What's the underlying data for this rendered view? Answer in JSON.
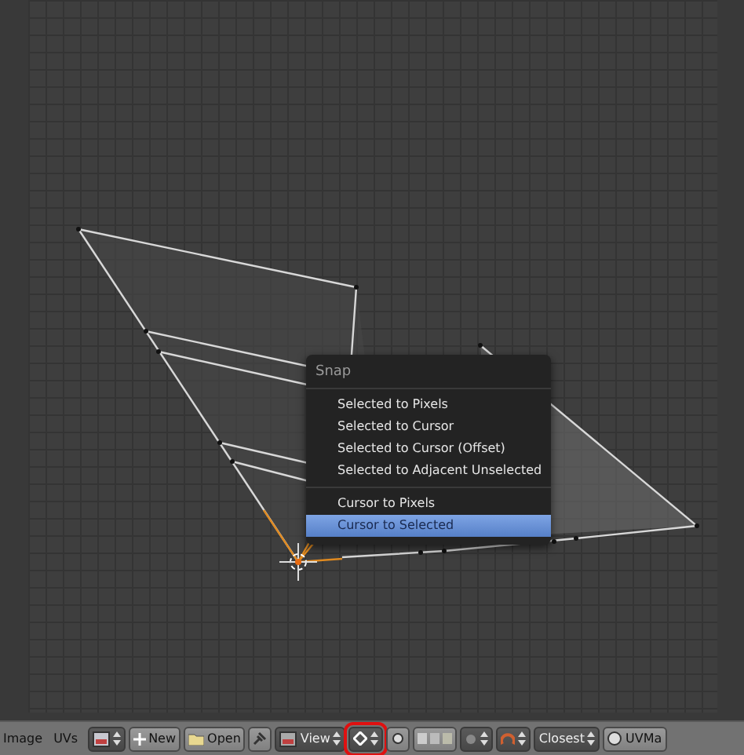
{
  "menu": {
    "title": "Snap",
    "sections": [
      [
        {
          "label": "Selected to Pixels",
          "selected": false
        },
        {
          "label": "Selected to Cursor",
          "selected": false
        },
        {
          "label": "Selected to Cursor (Offset)",
          "selected": false
        },
        {
          "label": "Selected to Adjacent Unselected",
          "selected": false
        }
      ],
      [
        {
          "label": "Cursor to Pixels",
          "selected": false
        },
        {
          "label": "Cursor to Selected",
          "selected": true
        }
      ]
    ]
  },
  "header": {
    "menus": [
      "Image",
      "UVs"
    ],
    "new_label": "New",
    "open_label": "Open",
    "view_label": "View",
    "pivot_highlighted": true,
    "snap_target": "Closest",
    "uv_map": "UVMa"
  }
}
